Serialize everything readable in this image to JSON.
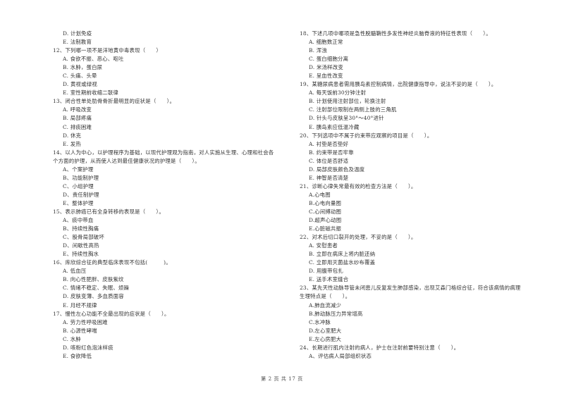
{
  "left_column": {
    "lead_options": [
      "D. 计划免疫",
      "E. 法制教育"
    ],
    "questions": [
      {
        "stem": "12、下列哪一项不是洋地黄中毒表现（　　）",
        "options": [
          "A. 食欲不振、恶心、呕吐",
          "B. 水肿，蛋白尿",
          "C. 头痛、头晕",
          "D. 黄视或绿视",
          "E. 室性期前收缩二联律"
        ]
      },
      {
        "stem": "13、闭合性单处肋骨骨折最明显的症状是（　　）。",
        "options": [
          "A. 呼吸改变",
          "B. 局部疼痛",
          "C. 排痰困难",
          "D. 休克",
          "E. 发热"
        ]
      },
      {
        "stem": "14、以人为中心，以护理程序为基础，以现代护理观为指南，对人实施从生理、心理和社会各",
        "stem_cont": "个方面的护理，从而使人达到最佳健康状况的护理是（　　）。",
        "options": [
          "A、个案护理",
          "B、功能制护理",
          "C、小组护理",
          "D、责任制护理",
          "E、整体护理"
        ]
      },
      {
        "stem": "15、表示肺癌已有全身转移的表现是（　　）。",
        "options": [
          "A、痰中带血",
          "B、持续性胸痛",
          "C、股骨局部破坏",
          "D、间歇性高热",
          "E、持续性胸水"
        ]
      },
      {
        "stem": "16、库欣综合征的典型临床表现不包括(　　　)。",
        "options": [
          "A. 低血压",
          "B. 向心性肥胖、皮肤紫纹",
          "C. 情绪不稳定、失眠、烦躁",
          "D. 皮肤变薄、多血质面容",
          "E. 月经不规律"
        ]
      },
      {
        "stem": "17、慢性左心功能不全最出现的症状是（　　）。",
        "options": [
          "A. 劳力性呼吸困难",
          "B. 心源性哮喘",
          "C. 水肿",
          "D. 咳粉红色泡沫样痰",
          "E. 食欲降低"
        ]
      }
    ]
  },
  "right_column": {
    "questions": [
      {
        "stem": "18、下述几项中哪项是急性脱髓鞘性多发性神经炎脑脊液的特征性表现（　　）。",
        "options": [
          "A. 细胞数正常",
          "B. 浑浊",
          "C. 蛋白细胞分离",
          "D. 米汤样改变",
          "E. 呈血性改变"
        ]
      },
      {
        "stem": "19、某糖尿病患者需用胰岛素控制病情，出院健康指导中，说法不妥的是（　　）。",
        "options": [
          "A. 每天饭前30分钟注射",
          "B. 计划使用注射部位，轮换注射",
          "C. 注射部位限制在两侧上肢的三角肌",
          "D. 针头与皮肤呈30°～40°进针",
          "E. 胰岛素应低温冷藏"
        ]
      },
      {
        "stem": "20、下列选项中不属于约束带应观察的项目是（　　）。",
        "options": [
          "A. 衬垫是否垫好",
          "B. 约束带是否牢靠",
          "C. 体位是否舒适",
          "D. 局部皮肤颜色及温度",
          "E. 神智是否清楚"
        ]
      },
      {
        "stem": "21、诊断心律失常最有效的检查方法是（　　）。",
        "options": [
          "A.心电图",
          "B.心电向量图",
          "C.心间搏动图",
          "D.超声心动图",
          "E.心脏磁共振"
        ]
      },
      {
        "stem": "22、对术后切口裂开的处理，不妥的是（　　）。",
        "options": [
          "A. 安慰患者",
          "B. 立即在病床上将内脏还纳",
          "C. 立即用灭菌盐水纱布覆盖",
          "D. 用腹带包扎",
          "E. 送手术室缝合"
        ]
      },
      {
        "stem": "23、某先天性动脉导管未闭患儿反复发生肺部感染，出现艾森门格综合征，符合该病情的病理",
        "stem_cont": "生理特点是（　　）。",
        "options": [
          "A.肺血流减少",
          "B.肺动脉压力异常增高",
          "C.水冲脉",
          "D.左心室肥大",
          "E.左心房肥大"
        ]
      },
      {
        "stem": "24、长期进行肌内注射的病人，护士在注射前要特别注意（　　）。",
        "options": [
          "A、评估病人局部组织状态"
        ]
      }
    ]
  },
  "footer": {
    "page_label": "第 2 页 共 17 页"
  }
}
